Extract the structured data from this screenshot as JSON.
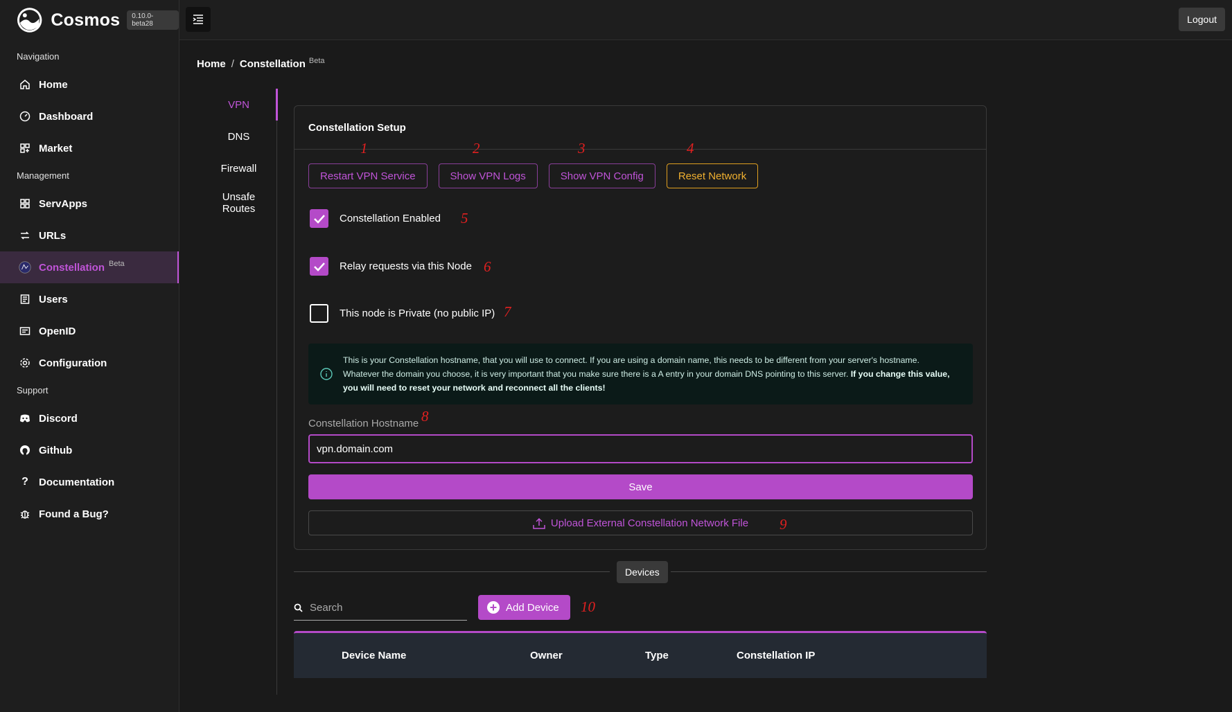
{
  "app": {
    "name": "Cosmos",
    "version": "0.10.0-beta28"
  },
  "sidebar": {
    "sections": [
      "Navigation",
      "Management",
      "Support"
    ],
    "navigation": [
      {
        "label": "Home",
        "icon": "home-icon"
      },
      {
        "label": "Dashboard",
        "icon": "dashboard-icon"
      },
      {
        "label": "Market",
        "icon": "market-icon"
      }
    ],
    "management": [
      {
        "label": "ServApps",
        "icon": "servapps-icon"
      },
      {
        "label": "URLs",
        "icon": "urls-icon"
      },
      {
        "label": "Constellation",
        "icon": "constellation-icon",
        "badge": "Beta",
        "active": true
      },
      {
        "label": "Users",
        "icon": "users-icon"
      },
      {
        "label": "OpenID",
        "icon": "openid-icon"
      },
      {
        "label": "Configuration",
        "icon": "gear-icon"
      }
    ],
    "support": [
      {
        "label": "Discord",
        "icon": "discord-icon"
      },
      {
        "label": "Github",
        "icon": "github-icon"
      },
      {
        "label": "Documentation",
        "icon": "question-icon"
      },
      {
        "label": "Found a Bug?",
        "icon": "bug-icon"
      }
    ]
  },
  "topbar": {
    "logout_label": "Logout"
  },
  "breadcrumb": {
    "home": "Home",
    "separator": "/",
    "current": "Constellation",
    "badge": "Beta"
  },
  "subtabs": [
    "VPN",
    "DNS",
    "Firewall",
    "Unsafe Routes"
  ],
  "setup": {
    "title": "Constellation Setup",
    "buttons": [
      "Restart VPN Service",
      "Show VPN Logs",
      "Show VPN Config",
      "Reset Network"
    ],
    "checkboxes": [
      {
        "label": "Constellation Enabled",
        "checked": true
      },
      {
        "label": "Relay requests via this Node",
        "checked": true
      },
      {
        "label": "This node is Private (no public IP)",
        "checked": false
      }
    ],
    "info_text": "This is your Constellation hostname, that you will use to connect. If you are using a domain name, this needs to be different from your server's hostname. Whatever the domain you choose, it is very important that you make sure there is a A entry in your domain DNS pointing to this server. ",
    "info_bold": "If you change this value, you will need to reset your network and reconnect all the clients!",
    "hostname_label": "Constellation Hostname",
    "hostname_value": "vpn.domain.com",
    "save_label": "Save",
    "upload_label": "Upload External Constellation Network File"
  },
  "annotations": [
    "1",
    "2",
    "3",
    "4",
    "5",
    "6",
    "7",
    "8",
    "9",
    "10"
  ],
  "devices": {
    "divider_label": "Devices",
    "search_placeholder": "Search",
    "add_label": "Add Device",
    "columns": [
      "Device Name",
      "Owner",
      "Type",
      "Constellation IP"
    ]
  },
  "colors": {
    "accent": "#b44ac8",
    "warning": "#e0a020",
    "annotation": "#e02020"
  }
}
